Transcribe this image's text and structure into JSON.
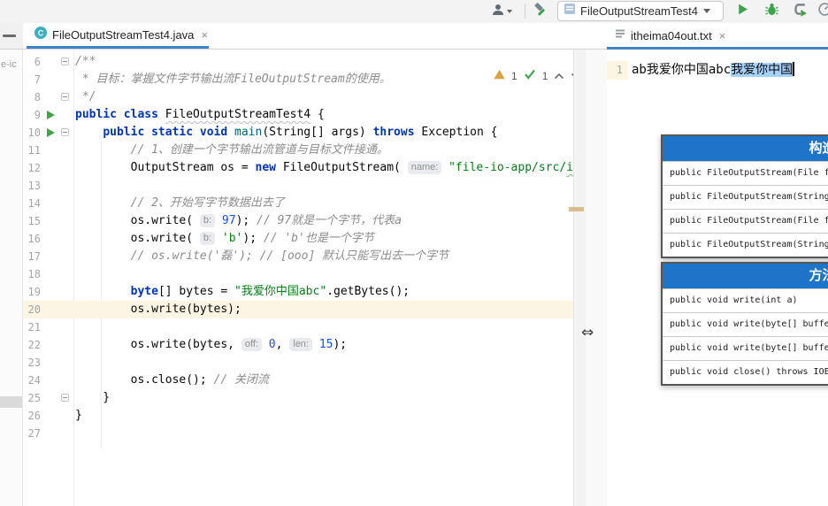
{
  "toolbar": {
    "run_config_label": "FileOutputStreamTest4",
    "icons": {
      "user": "user-icon",
      "build": "build-hammer-icon",
      "run": "run-play-icon",
      "debug": "debug-bug-icon",
      "coverage": "run-with-coverage-icon",
      "profiler": "profiler-icon"
    }
  },
  "tabs": {
    "left": {
      "title": "FileOutputStreamTest4.java",
      "close": "×"
    },
    "right": {
      "title": "itheima04out.txt",
      "close": "×"
    }
  },
  "left_strip": {
    "collapsed_text": "e-ic"
  },
  "left_editor": {
    "inspections": {
      "warning_count": "1",
      "ok_count": "1"
    },
    "lines": [
      {
        "num": "6",
        "fold": true,
        "seg": [
          {
            "c": "c",
            "t": "/**"
          }
        ]
      },
      {
        "num": "7",
        "seg": [
          {
            "c": "c",
            "t": " * 目标：掌握文件字节输出流FileOutputStream的使用。"
          }
        ]
      },
      {
        "num": "8",
        "fold": true,
        "seg": [
          {
            "c": "c",
            "t": " */"
          }
        ]
      },
      {
        "num": "9",
        "run": true,
        "seg": [
          {
            "c": "k",
            "t": "public class "
          },
          {
            "c": "d",
            "t": "FileOutputStreamTest4"
          },
          {
            "c": "p",
            "t": " {"
          }
        ]
      },
      {
        "num": "10",
        "run": true,
        "fold": true,
        "seg": [
          {
            "c": "p",
            "t": "    "
          },
          {
            "c": "k",
            "t": "public static void "
          },
          {
            "c": "m",
            "t": "main"
          },
          {
            "c": "p",
            "t": "(String[] args) "
          },
          {
            "c": "k",
            "t": "throws "
          },
          {
            "c": "p",
            "t": "Exception {"
          }
        ]
      },
      {
        "num": "11",
        "seg": [
          {
            "c": "p",
            "t": "        "
          },
          {
            "c": "c",
            "t": "// 1、创建一个字节输出流管道与目标文件接通。"
          }
        ]
      },
      {
        "num": "12",
        "seg": [
          {
            "c": "p",
            "t": "        OutputStream os = "
          },
          {
            "c": "k",
            "t": "new "
          },
          {
            "c": "p",
            "t": "FileOutputStream( "
          },
          {
            "c": "h",
            "t": "name:"
          },
          {
            "c": "p",
            "t": " "
          },
          {
            "c": "s",
            "t": "\"file-io-app/src/"
          },
          {
            "c": "sw",
            "t": "ithe"
          }
        ]
      },
      {
        "num": "13",
        "seg": []
      },
      {
        "num": "14",
        "seg": [
          {
            "c": "p",
            "t": "        "
          },
          {
            "c": "c",
            "t": "// 2、开始写字节数据出去了"
          }
        ]
      },
      {
        "num": "15",
        "seg": [
          {
            "c": "p",
            "t": "        os.write( "
          },
          {
            "c": "h",
            "t": "b:"
          },
          {
            "c": "p",
            "t": " "
          },
          {
            "c": "n",
            "t": "97"
          },
          {
            "c": "p",
            "t": "); "
          },
          {
            "c": "c",
            "t": "// 97就是一个字节，代表a"
          }
        ]
      },
      {
        "num": "16",
        "seg": [
          {
            "c": "p",
            "t": "        os.write( "
          },
          {
            "c": "h",
            "t": "b:"
          },
          {
            "c": "p",
            "t": " "
          },
          {
            "c": "s",
            "t": "'b'"
          },
          {
            "c": "p",
            "t": "); "
          },
          {
            "c": "c",
            "t": "// 'b'也是一个字节"
          }
        ]
      },
      {
        "num": "17",
        "seg": [
          {
            "c": "p",
            "t": "        "
          },
          {
            "c": "c",
            "t": "// os.write('磊'); // [ooo] 默认只能写出去一个字节"
          }
        ]
      },
      {
        "num": "18",
        "seg": []
      },
      {
        "num": "19",
        "seg": [
          {
            "c": "p",
            "t": "        "
          },
          {
            "c": "k",
            "t": "byte"
          },
          {
            "c": "p",
            "t": "[] bytes = "
          },
          {
            "c": "s",
            "t": "\"我爱你中国abc\""
          },
          {
            "c": "p",
            "t": ".getBytes();"
          }
        ]
      },
      {
        "num": "20",
        "hl": true,
        "seg": [
          {
            "c": "p",
            "t": "        os.write(bytes);"
          }
        ]
      },
      {
        "num": "21",
        "seg": []
      },
      {
        "num": "22",
        "seg": [
          {
            "c": "p",
            "t": "        os.write(bytes, "
          },
          {
            "c": "h",
            "t": "off:"
          },
          {
            "c": "p",
            "t": " "
          },
          {
            "c": "n",
            "t": "0"
          },
          {
            "c": "p",
            "t": ", "
          },
          {
            "c": "h",
            "t": "len:"
          },
          {
            "c": "p",
            "t": " "
          },
          {
            "c": "n",
            "t": "15"
          },
          {
            "c": "p",
            "t": ");"
          }
        ]
      },
      {
        "num": "23",
        "seg": []
      },
      {
        "num": "24",
        "seg": [
          {
            "c": "p",
            "t": "        os.close(); "
          },
          {
            "c": "c",
            "t": "// 关闭流"
          }
        ]
      },
      {
        "num": "25",
        "fold": true,
        "seg": [
          {
            "c": "p",
            "t": "    }"
          }
        ]
      },
      {
        "num": "26",
        "seg": [
          {
            "c": "p",
            "t": "}"
          }
        ]
      },
      {
        "num": "27",
        "seg": []
      }
    ]
  },
  "right_editor": {
    "line_number": "1",
    "text_plain": "ab我爱你中国abc",
    "text_selected": "我爱你中国"
  },
  "overlay_tables": [
    {
      "header": "构造器",
      "rows": [
        "public FileOutputStream(File f",
        "public FileOutputStream(String",
        "public FileOutputStream(File f",
        "public FileOutputStream(String"
      ]
    },
    {
      "header": "方法名",
      "rows": [
        "public void write(int a)",
        "public void write(byte[] buffe",
        "public void write(byte[] buffe",
        "public void close() throws IOE"
      ]
    }
  ],
  "colors": {
    "accent_blue": "#4083c9",
    "run_green": "#3fa34b",
    "selection_blue": "#a6d2ff",
    "caret_row_cream": "#fcf5e3",
    "table_header_blue": "#1e74c8",
    "warning_tan": "#d9a343",
    "keyword_blue": "#0033b3",
    "string_green": "#067d17",
    "number_blue": "#1750eb",
    "comment_gray": "#8c8c8c",
    "scroll_mark_tan": "#d9bd8d"
  }
}
